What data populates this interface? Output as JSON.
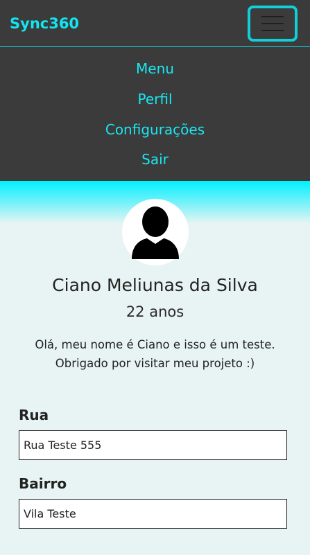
{
  "navbar": {
    "brand": "Sync360",
    "toggle_icon": "hamburger-menu-icon"
  },
  "menu": {
    "items": [
      {
        "label": "Menu"
      },
      {
        "label": "Perfil"
      },
      {
        "label": "Configurações"
      },
      {
        "label": "Sair"
      }
    ]
  },
  "profile": {
    "avatar_icon": "user-silhouette-icon",
    "name": "Ciano Meliunas da Silva",
    "age": "22 anos",
    "bio_line1": "Olá, meu nome é Ciano e isso é um teste.",
    "bio_line2": "Obrigado por visitar meu projeto :)"
  },
  "form": {
    "rua": {
      "label": "Rua",
      "value": "Rua Teste 555"
    },
    "bairro": {
      "label": "Bairro",
      "value": "Vila Teste"
    }
  },
  "colors": {
    "accent": "#12e6f2",
    "navbar_bg": "#3b3b3b",
    "page_bg": "#e8f4f3"
  }
}
